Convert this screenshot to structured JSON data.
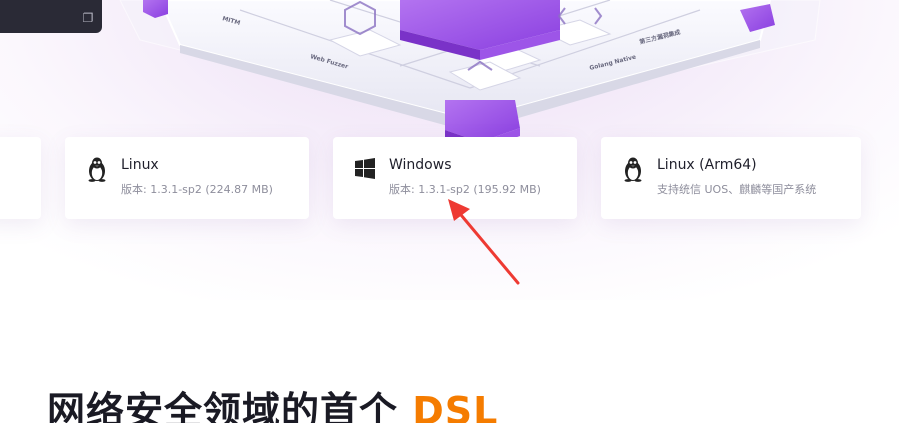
{
  "cards": [
    {
      "title": "Linux",
      "subtitle": "版本: 1.3.1-sp2 (224.87 MB)",
      "icon": "linux-penguin-icon"
    },
    {
      "title": "Windows",
      "subtitle": "版本: 1.3.1-sp2 (195.92 MB)",
      "icon": "windows-logo-icon"
    },
    {
      "title": "Linux (Arm64)",
      "subtitle": "支持统信 UOS、麒麟等国产系统",
      "icon": "linux-penguin-icon"
    }
  ],
  "headline": {
    "text": "网络安全领域的首个",
    "accent": "DSL"
  },
  "hero_labels": [
    "MITM",
    "Web Fuzzer",
    "Golang Native",
    "第三方漏洞集成"
  ],
  "colors": {
    "accent": "#f57c00",
    "hero_purple": "#9b4de0",
    "annotation_arrow": "#ee3a33"
  }
}
